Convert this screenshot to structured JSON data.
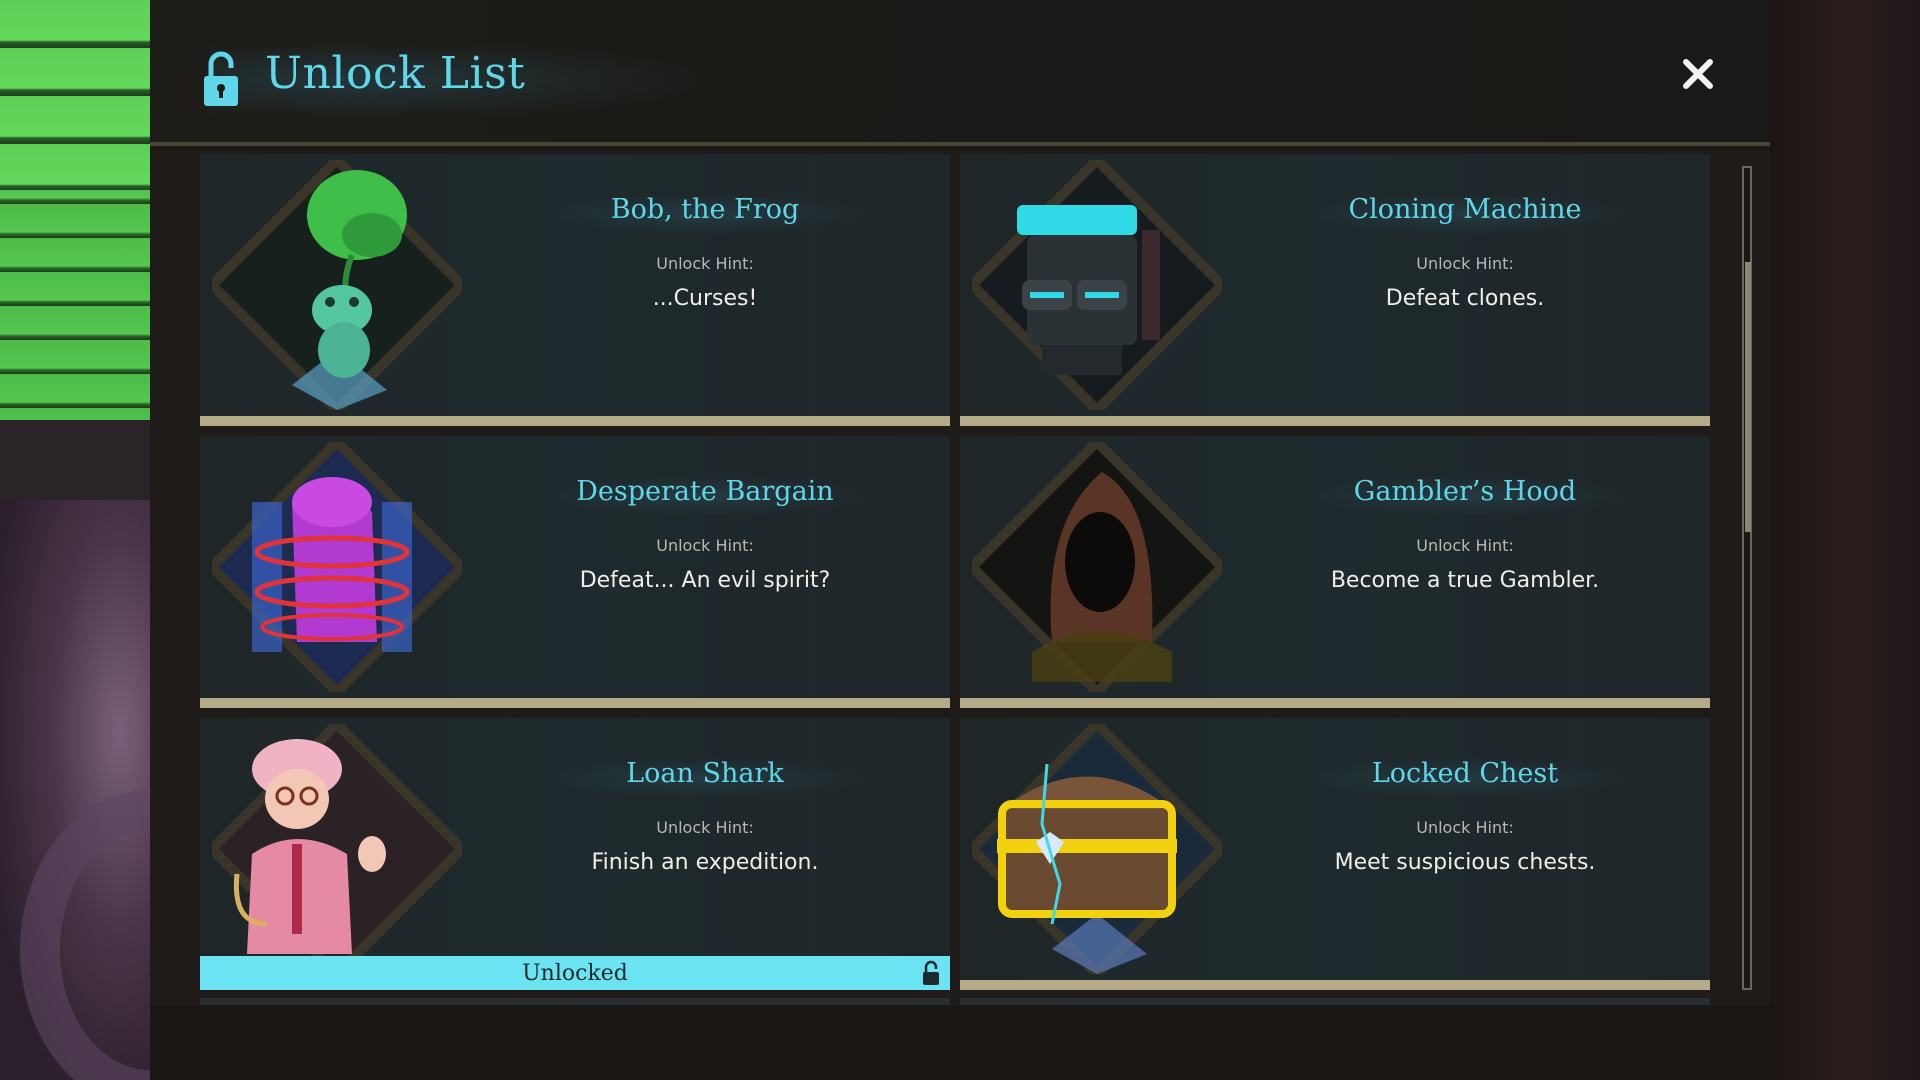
{
  "header": {
    "title": "Unlock List"
  },
  "cards": [
    {
      "name": "Bob, the Frog",
      "hint_label": "Unlock Hint:",
      "hint": "...Curses!",
      "unlocked": false
    },
    {
      "name": "Cloning Machine",
      "hint_label": "Unlock Hint:",
      "hint": "Defeat clones.",
      "unlocked": false
    },
    {
      "name": "Desperate Bargain",
      "hint_label": "Unlock Hint:",
      "hint": "Defeat... An evil spirit?",
      "unlocked": false
    },
    {
      "name": "Gambler’s Hood",
      "hint_label": "Unlock Hint:",
      "hint": "Become a true Gambler.",
      "unlocked": false
    },
    {
      "name": "Loan Shark",
      "hint_label": "Unlock Hint:",
      "hint": "Finish an expedition.",
      "unlocked": true,
      "status": "Unlocked"
    },
    {
      "name": "Locked Chest",
      "hint_label": "Unlock Hint:",
      "hint": "Meet suspicious chests.",
      "unlocked": false
    }
  ],
  "colors": {
    "accent": "#5fd6ea",
    "unlocked_bar": "#6ce3f3",
    "locked_bar": "#b6ab88"
  },
  "icons": {
    "header": "padlock-open-icon",
    "close": "close-icon"
  }
}
